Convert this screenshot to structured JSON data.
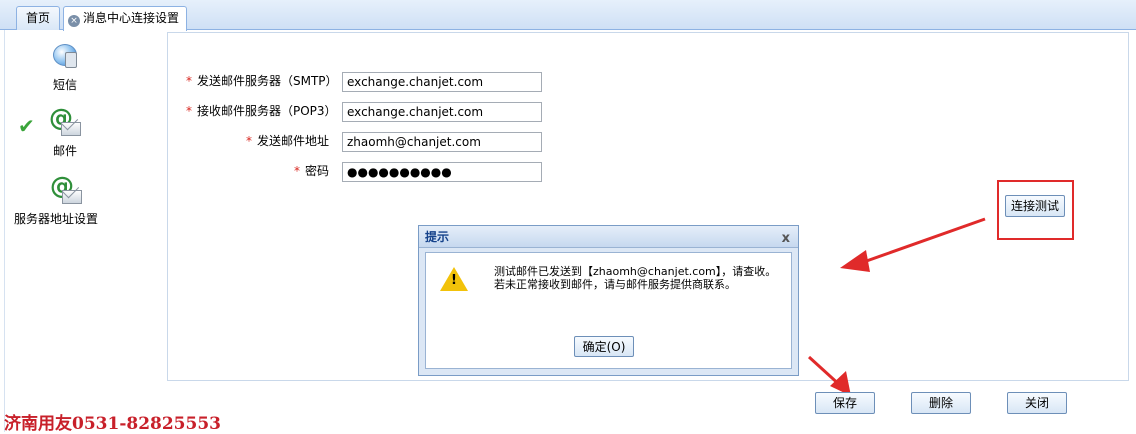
{
  "tabs": {
    "home": "首页",
    "active": "消息中心连接设置"
  },
  "nav": {
    "sms": "短信",
    "mail": "邮件",
    "server": "服务器地址设置"
  },
  "form": {
    "smtp_label": "发送邮件服务器（SMTP）",
    "smtp_value": "exchange.chanjet.com",
    "pop3_label": "接收邮件服务器（POP3）",
    "pop3_value": "exchange.chanjet.com",
    "address_label": "发送邮件地址",
    "address_value": "zhaomh@chanjet.com",
    "password_label": "密码",
    "password_value": "●●●●●●●●●●",
    "required_mark": "*"
  },
  "buttons": {
    "test": "连接测试",
    "save": "保存",
    "delete": "删除",
    "close": "关闭"
  },
  "dialog": {
    "title": "提示",
    "close": "x",
    "line1": "测试邮件已发送到【zhaomh@chanjet.com】，请查收。",
    "line2": "若未正常接收到邮件，请与邮件服务提供商联系。",
    "ok": "确定(O)"
  },
  "watermark": "济南用友0531-82825553",
  "colors": {
    "annotation_red": "#e02a2a",
    "accent_blue": "#8db2e3"
  }
}
